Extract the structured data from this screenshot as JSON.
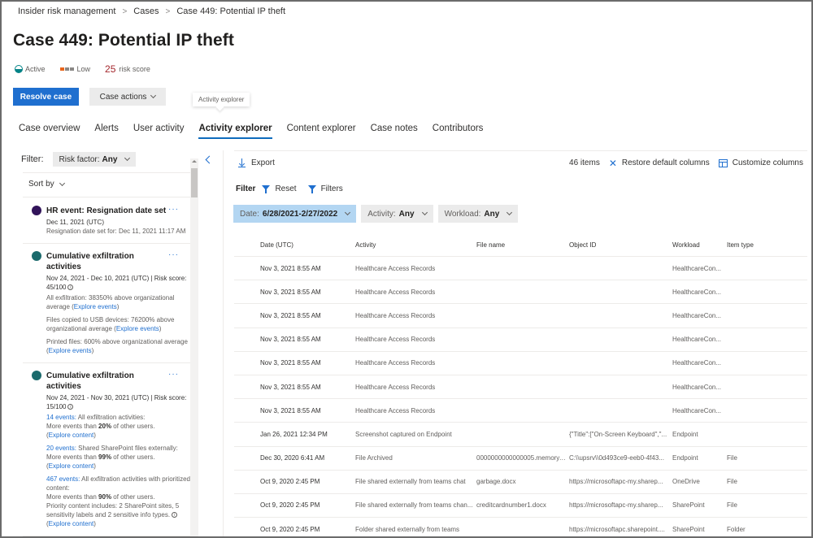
{
  "breadcrumb": [
    "Insider risk management",
    "Cases",
    "Case 449: Potential IP theft"
  ],
  "page_title": "Case 449: Potential IP theft",
  "status": {
    "state": "Active",
    "severity": "Low",
    "severity_level": 1,
    "severity_max": 3,
    "risk_score_value": "25",
    "risk_score_label": "risk score",
    "colors": {
      "active": "#038387",
      "severity": "#e8651b",
      "risk": "#a4262c"
    }
  },
  "actions": {
    "resolve": "Resolve case",
    "case_actions": "Case actions"
  },
  "tooltip": "Activity explorer",
  "tabs": [
    {
      "label": "Case overview",
      "active": false
    },
    {
      "label": "Alerts",
      "active": false
    },
    {
      "label": "User activity",
      "active": false
    },
    {
      "label": "Activity explorer",
      "active": true
    },
    {
      "label": "Content explorer",
      "active": false
    },
    {
      "label": "Case notes",
      "active": false
    },
    {
      "label": "Contributors",
      "active": false
    }
  ],
  "left_panel": {
    "filter_label": "Filter:",
    "risk_factor_label": "Risk factor:",
    "risk_factor_value": "Any",
    "sort_by": "Sort by",
    "cards": [
      {
        "title": "HR event: Resignation date set",
        "dot_color": "#32145a",
        "date": "Dec 11, 2021 (UTC)",
        "detail": "Resignation date set for: Dec 11, 2021 11:17 AM"
      },
      {
        "title": "Cumulative exfiltration activities",
        "dot_color": "#1b6a6c",
        "date": "Nov 24, 2021 - Dec 10, 2021 (UTC) | Risk score: 45/100",
        "lines": [
          {
            "text": "All exfiltration: 38350% above organizational average (",
            "link": "Explore events",
            "tail": ")"
          },
          {
            "text": "Files copied to USB devices: 76200% above organizational average (",
            "link": "Explore events",
            "tail": ")"
          },
          {
            "text": "Printed files: 600% above organizational average (",
            "link": "Explore events",
            "tail": ")"
          }
        ]
      },
      {
        "title": "Cumulative exfiltration activities",
        "dot_color": "#1b6a6c",
        "date": "Nov 24, 2021 - Nov 30, 2021 (UTC) | Risk score: 15/100",
        "events": [
          {
            "count": "14 events:",
            "desc": "All exfiltration activities:",
            "pre": "More events than ",
            "pct": "20%",
            "post": " of other users.",
            "link": "Explore content"
          },
          {
            "count": "20 events:",
            "desc": "Shared SharePoint files externally:",
            "pre": "More events than ",
            "pct": "99%",
            "post": " of other users.",
            "link": "Explore content"
          },
          {
            "count": "467 events:",
            "desc": "All exfiltration activities with prioritized content:",
            "pre": "More events than ",
            "pct": "90%",
            "post": " of other users.",
            "extra": "Priority content includes: 2 SharePoint sites, 5 sensitivity labels and 2 sensitive info types.",
            "link": "Explore content"
          }
        ]
      }
    ]
  },
  "toolbar": {
    "export": "Export",
    "items_count": "46 items",
    "restore": "Restore default columns",
    "customize": "Customize columns"
  },
  "filter_bar": {
    "label": "Filter",
    "reset": "Reset",
    "filters": "Filters",
    "chips": [
      {
        "label": "Date:",
        "value": "6/28/2021-2/27/2022",
        "selected": true
      },
      {
        "label": "Activity:",
        "value": "Any",
        "selected": false
      },
      {
        "label": "Workload:",
        "value": "Any",
        "selected": false
      }
    ]
  },
  "table": {
    "columns": [
      "Date (UTC)",
      "Activity",
      "File name",
      "Object ID",
      "Workload",
      "Item type"
    ],
    "rows": [
      [
        "Nov 3, 2021 8:55 AM",
        "Healthcare Access Records",
        "",
        "",
        "HealthcareCon...",
        ""
      ],
      [
        "Nov 3, 2021 8:55 AM",
        "Healthcare Access Records",
        "",
        "",
        "HealthcareCon...",
        ""
      ],
      [
        "Nov 3, 2021 8:55 AM",
        "Healthcare Access Records",
        "",
        "",
        "HealthcareCon...",
        ""
      ],
      [
        "Nov 3, 2021 8:55 AM",
        "Healthcare Access Records",
        "",
        "",
        "HealthcareCon...",
        ""
      ],
      [
        "Nov 3, 2021 8:55 AM",
        "Healthcare Access Records",
        "",
        "",
        "HealthcareCon...",
        ""
      ],
      [
        "Nov 3, 2021 8:55 AM",
        "Healthcare Access Records",
        "",
        "",
        "HealthcareCon...",
        ""
      ],
      [
        "Nov 3, 2021 8:55 AM",
        "Healthcare Access Records",
        "",
        "",
        "HealthcareCon...",
        ""
      ],
      [
        "Jan 26, 2021 12:34 PM",
        "Screenshot captured on Endpoint",
        "",
        "{\"Title\":[\"On-Screen Keyboard\",\"...",
        "Endpoint",
        ""
      ],
      [
        "Dec 30, 2020 6:41 AM",
        "File Archived",
        "0000000000000005.memory....",
        "C:\\\\upsrv\\\\0d493ce9-eeb0-4f43...",
        "Endpoint",
        "File"
      ],
      [
        "Oct 9, 2020 2:45 PM",
        "File shared externally from teams chat",
        "garbage.docx",
        "https://microsoftapc-my.sharep...",
        "OneDrive",
        "File"
      ],
      [
        "Oct 9, 2020 2:45 PM",
        "File shared externally from teams chan...",
        "creditcardnumber1.docx",
        "https://microsoftapc-my.sharep...",
        "SharePoint",
        "File"
      ],
      [
        "Oct 9, 2020 2:45 PM",
        "Folder shared externally from teams",
        "",
        "https://microsoftapc.sharepoint....",
        "SharePoint",
        "Folder"
      ]
    ]
  }
}
